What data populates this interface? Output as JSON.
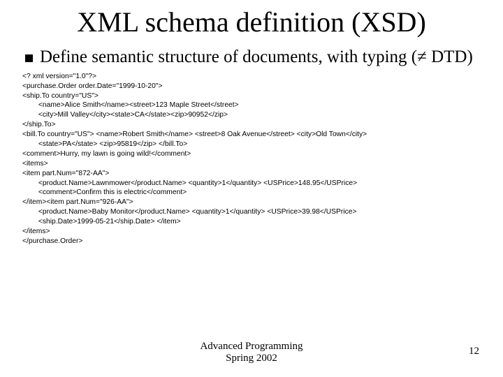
{
  "title": "XML schema definition (XSD)",
  "bullet": "Define semantic structure of documents, with typing (≠ DTD)",
  "xml": "<? xml version=\"1.0\"?>\n<purchase.Order order.Date=\"1999-10-20\">\n<ship.To country=\"US\">\n        <name>Alice Smith</name><street>123 Maple Street</street>\n        <city>Mill Valley</city><state>CA</state><zip>90952</zip>\n</ship.To>\n<bill.To country=\"US\"> <name>Robert Smith</name> <street>8 Oak Avenue</street> <city>Old Town</city>\n        <state>PA</state> <zip>95819</zip> </bill.To>\n<comment>Hurry, my lawn is going wild!</comment>\n<items>\n<item part.Num=\"872-AA\">\n        <product.Name>Lawnmower</product.Name> <quantity>1</quantity> <USPrice>148.95</USPrice>\n        <comment>Confirm this is electric</comment>\n</item><item part.Num=\"926-AA\">\n        <product.Name>Baby Monitor</product.Name> <quantity>1</quantity> <USPrice>39.98</USPrice>\n        <ship.Date>1999-05-21</ship.Date> </item>\n</items>\n</purchase.Order>",
  "footer_line1": "Advanced Programming",
  "footer_line2": "Spring 2002",
  "page_number": "12"
}
